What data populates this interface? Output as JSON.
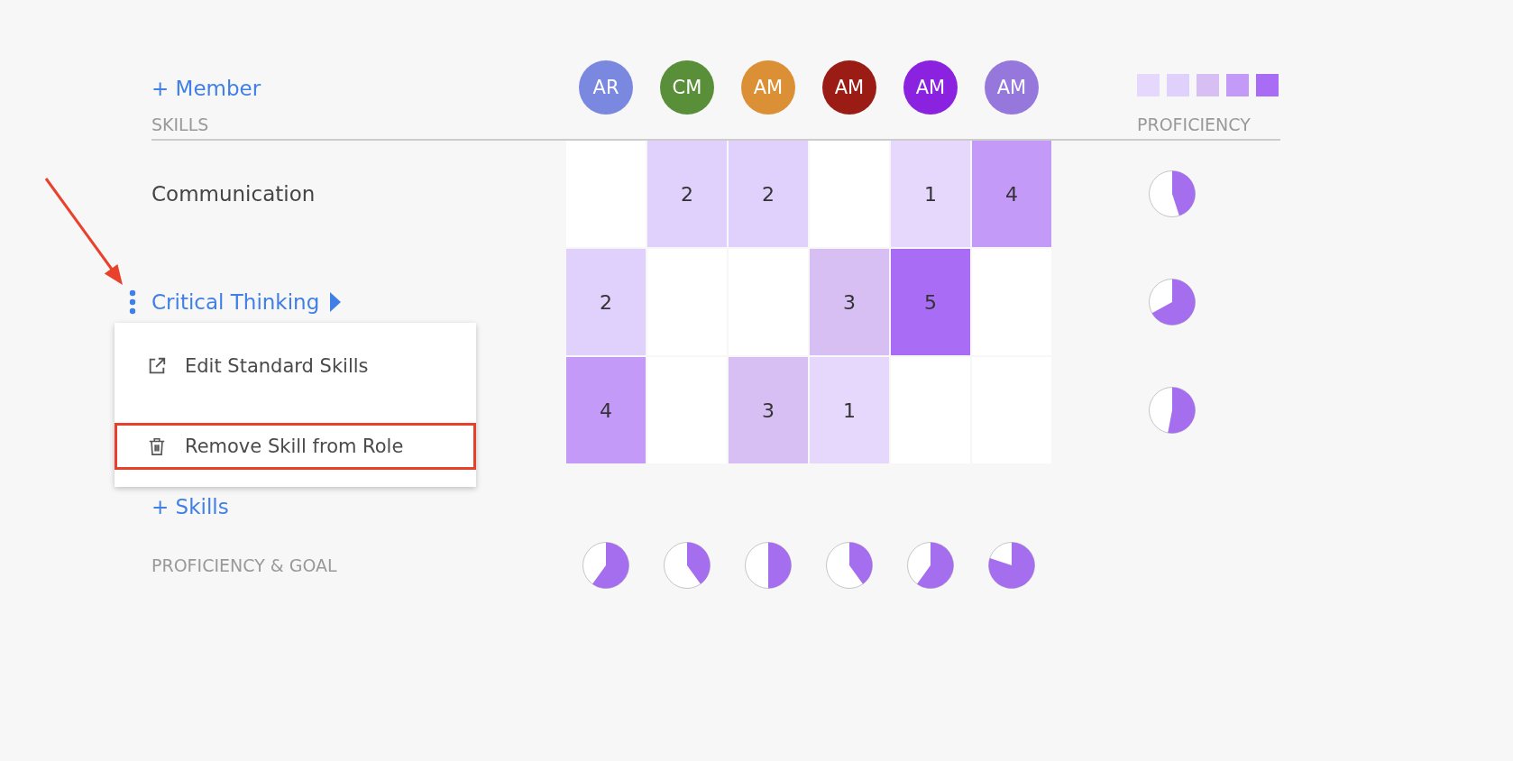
{
  "header": {
    "add_member": "+ Member",
    "skills_heading": "SKILLS",
    "proficiency_heading": "PROFICIENCY"
  },
  "legend": [
    {
      "color": "#e6d7fd"
    },
    {
      "color": "#e0d0fc"
    },
    {
      "color": "#d7bff3"
    },
    {
      "color": "#c49af8"
    },
    {
      "color": "#a96cf5"
    }
  ],
  "members": [
    {
      "initials": "AR",
      "color": "#7b88e0"
    },
    {
      "initials": "CM",
      "color": "#5a8f3a"
    },
    {
      "initials": "AM",
      "color": "#dc9035"
    },
    {
      "initials": "AM",
      "color": "#9a1c15"
    },
    {
      "initials": "AM",
      "color": "#8a22e0"
    },
    {
      "initials": "AM",
      "color": "#9678dd"
    }
  ],
  "pointer_arrow": true,
  "skills": [
    {
      "label": "Communication",
      "menu_open": false,
      "cells": [
        {
          "color": "#ffffff"
        },
        {
          "value": "2",
          "color": "#e0d0fc"
        },
        {
          "value": "2",
          "color": "#e0d0fc"
        },
        {
          "color": "#ffffff"
        },
        {
          "value": "1",
          "color": "#e6d7fd"
        },
        {
          "value": "4",
          "color": "#c49af8"
        }
      ]
    },
    {
      "label": "Critical Thinking",
      "menu_open": true,
      "cells": [
        {
          "value": "2",
          "color": "#e0d0fc"
        },
        {
          "color": "#ffffff"
        },
        {
          "color": "#ffffff"
        },
        {
          "value": "3",
          "color": "#d7bff3"
        },
        {
          "value": "5",
          "color": "#a96cf5"
        },
        {
          "color": "#ffffff"
        }
      ]
    },
    {
      "cells": [
        {
          "value": "4",
          "color": "#c49af8"
        },
        {
          "color": "#ffffff"
        },
        {
          "value": "3",
          "color": "#d7bff3"
        },
        {
          "value": "1",
          "color": "#e6d7fd"
        },
        {
          "color": "#ffffff"
        },
        {
          "color": "#ffffff"
        }
      ]
    }
  ],
  "menu": {
    "items": [
      {
        "label": "Edit Standard Skills",
        "kind": "link",
        "highlighted": false
      },
      {
        "label": "Remove Skill from Role",
        "kind": "delete",
        "highlighted": true
      }
    ]
  },
  "add_skills": "+ Skills",
  "goal": {
    "label": "PROFICIENCY & GOAL"
  }
}
